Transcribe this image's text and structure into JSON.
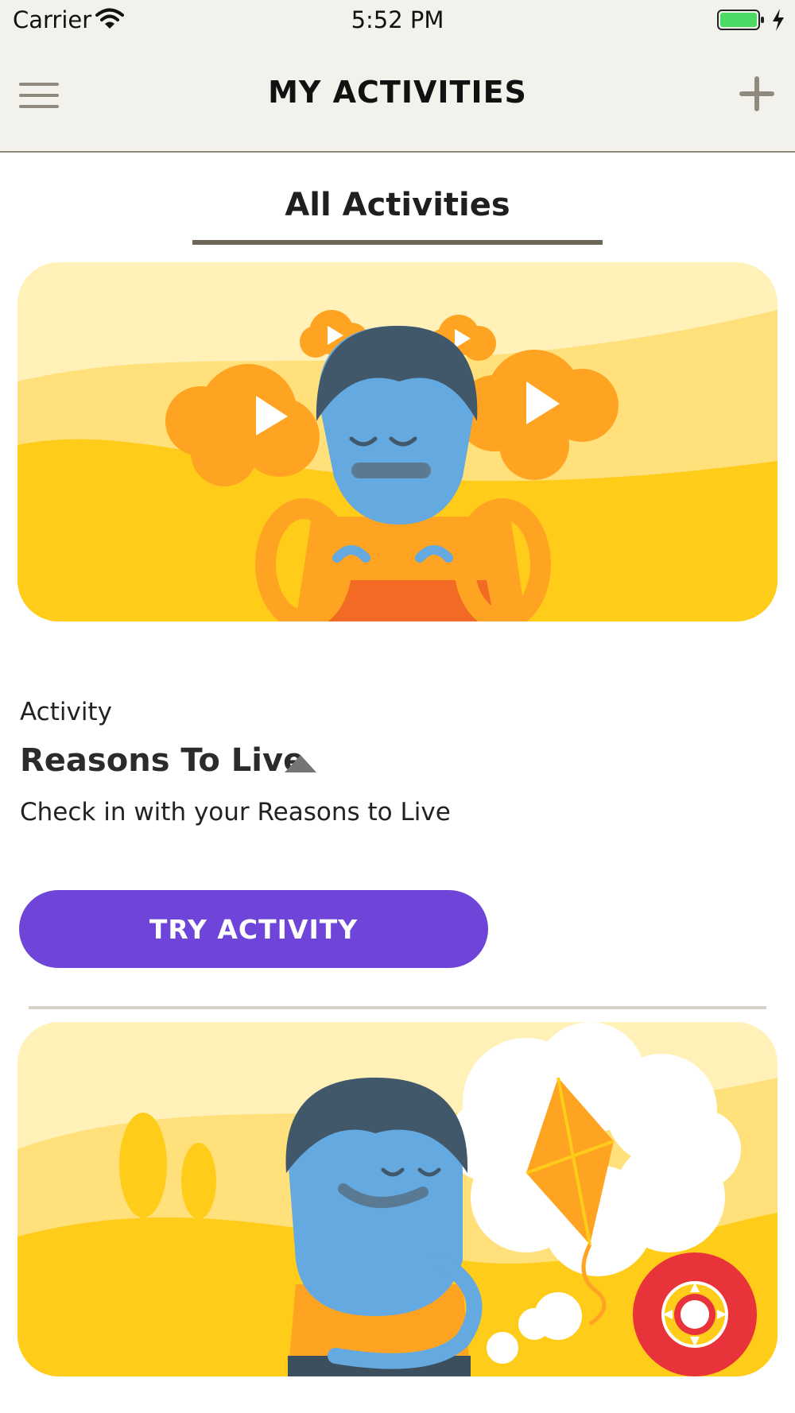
{
  "status_bar": {
    "carrier": "Carrier",
    "time": "5:52 PM",
    "battery_color": "#4cd964"
  },
  "nav": {
    "title": "MY ACTIVITIES",
    "menu_icon": "hamburger-icon",
    "add_icon": "plus-icon"
  },
  "tabs": {
    "active_label": "All Activities"
  },
  "activity": {
    "kicker": "Activity",
    "title": "Reasons To Live",
    "description": "Check in with your Reasons to Live",
    "button_label": "TRY ACTIVITY",
    "button_color": "#6f45d9"
  },
  "illustrations": [
    "meditating-character-with-play-clouds-illustration",
    "character-thinking-of-kite-illustration"
  ],
  "help_button": {
    "icon": "lifebuoy-icon",
    "color": "#e8333a"
  }
}
